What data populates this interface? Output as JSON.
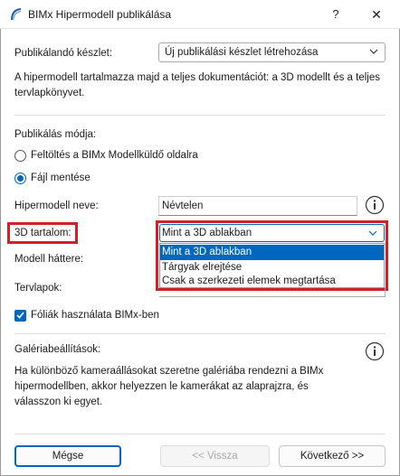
{
  "window": {
    "title": "BIMx Hipermodell publikálása",
    "help_glyph": "?",
    "close_glyph": "✕",
    "app_icon": "archicad-arc-icon"
  },
  "publish_set": {
    "label": "Publikálandó készlet:",
    "selected": "Új publikálási készlet létrehozása",
    "description": "A hipermodell tartalmazza majd a teljes dokumentációt: a 3D modellt és a teljes tervlapkönyvet."
  },
  "publish_mode": {
    "label": "Publikálás módja:",
    "options": [
      {
        "label": "Feltöltés a BIMx Modellküldő oldalra",
        "selected": false
      },
      {
        "label": "Fájl mentése",
        "selected": true
      }
    ]
  },
  "hypermodel_name": {
    "label": "Hipermodell neve:",
    "value": "Névtelen",
    "info_icon": "info-icon"
  },
  "content_3d": {
    "label": "3D tartalom:",
    "selected": "Mint a 3D ablakban",
    "options": [
      {
        "label": "Mint a 3D ablakban",
        "selected": true
      },
      {
        "label": "Tárgyak elrejtése",
        "selected": false
      },
      {
        "label": "Csak a szerkezeti elemek megtartása",
        "selected": false
      }
    ],
    "highlight_color": "#d0202a"
  },
  "model_background": {
    "label": "Modell háttere:"
  },
  "sheets": {
    "label": "Tervlapok:"
  },
  "layers": {
    "label": "Fóliák használata BIMx-ben",
    "checked": true
  },
  "gallery": {
    "label": "Galériabeállítások:",
    "text": "Ha különböző kameraállásokat szeretne galériába rendezni a BIMx hipermodellben, akkor helyezzen le kamerákat az alaprajzra, és válasszon ki egyet.",
    "info_icon": "info-icon"
  },
  "footer": {
    "cancel": "Mégse",
    "back": "<< Vissza",
    "next": "Következő >>"
  },
  "colors": {
    "accent": "#0067c0",
    "highlight": "#d0202a"
  }
}
